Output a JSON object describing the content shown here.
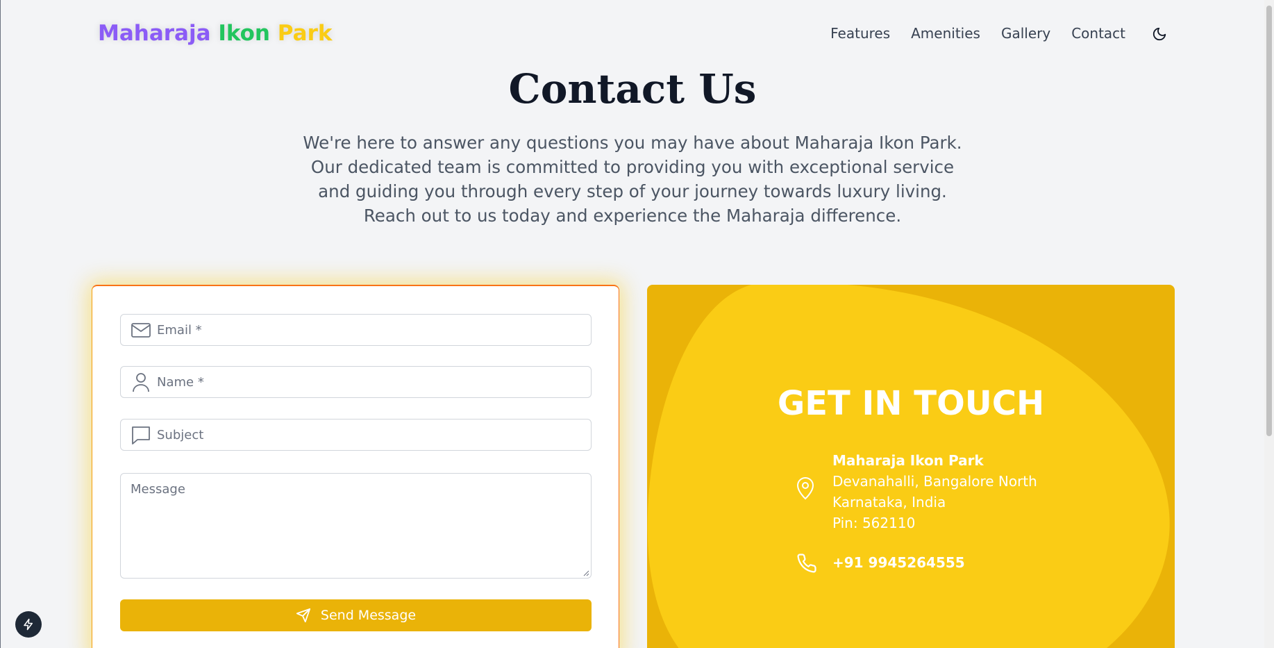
{
  "header": {
    "logo": {
      "word1": "Maharaja",
      "word2": "Ikon",
      "word3": "Park"
    },
    "nav": [
      "Features",
      "Amenities",
      "Gallery",
      "Contact"
    ],
    "theme_toggle_icon": "moon-icon"
  },
  "hero": {
    "title": "Contact Us",
    "intro": "We're here to answer any questions you may have about Maharaja Ikon Park. Our dedicated team is committed to providing you with exceptional service and guiding you through every step of your journey towards luxury living. Reach out to us today and experience the Maharaja difference."
  },
  "form": {
    "email_placeholder": "Email *",
    "name_placeholder": "Name *",
    "subject_placeholder": "Subject",
    "message_placeholder": "Message",
    "send_label": "Send Message"
  },
  "contact": {
    "heading": "GET IN TOUCH",
    "company": "Maharaja Ikon Park",
    "address_line1": "Devanahalli, Bangalore North",
    "address_line2": "Karnataka, India",
    "pin": "Pin: 562110",
    "phone": "+91 9945264555"
  },
  "colors": {
    "logo_purple": "#8b5cf6",
    "logo_green": "#22c55e",
    "logo_yellow": "#facc15",
    "accent": "#eab308",
    "card_blob": "#facc15"
  }
}
